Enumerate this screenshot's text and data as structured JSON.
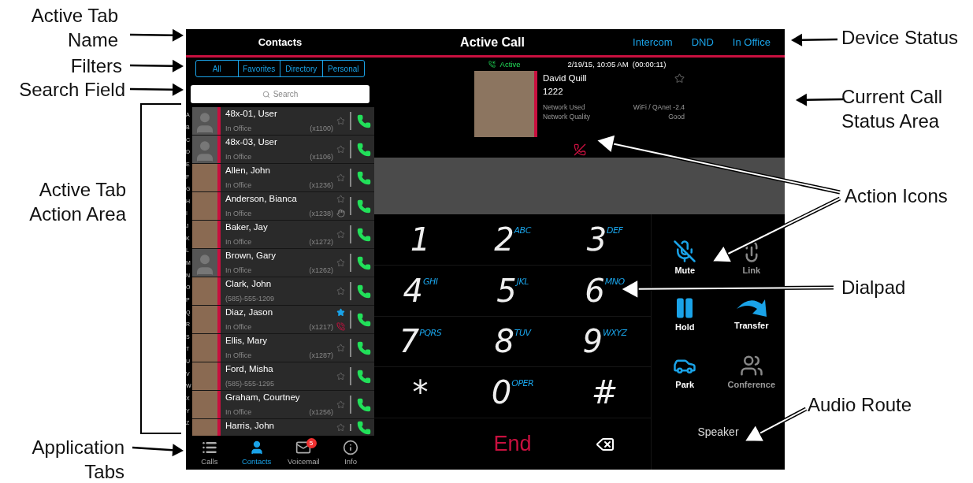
{
  "annotations": [
    {
      "text": "Active Tab Name"
    },
    {
      "text": "Filters"
    },
    {
      "text": "Search Field"
    },
    {
      "text": "Active Tab Action Area"
    },
    {
      "text": "Application Tabs"
    },
    {
      "text": "Device Status"
    },
    {
      "text": "Current Call Status Area"
    },
    {
      "text": "Action Icons"
    },
    {
      "text": "Dialpad"
    },
    {
      "text": "Audio Route"
    }
  ],
  "header": {
    "tab_title": "Contacts",
    "title": "Active Call",
    "device_status": [
      "Intercom",
      "DND",
      "In Office"
    ]
  },
  "filters": [
    {
      "label": "All",
      "selected": false
    },
    {
      "label": "Favorites",
      "selected": false
    },
    {
      "label": "Directory",
      "selected": false
    },
    {
      "label": "Personal",
      "selected": false
    }
  ],
  "search": {
    "placeholder": "Search"
  },
  "index_letters": [
    "A",
    "B",
    "C",
    "D",
    "E",
    "F",
    "G",
    "H",
    "I",
    "J",
    "K",
    "L",
    "M",
    "N",
    "O",
    "P",
    "Q",
    "R",
    "S",
    "T",
    "U",
    "V",
    "W",
    "X",
    "Y",
    "Z"
  ],
  "contacts": [
    {
      "name": "48x-01, User",
      "status": "In Office",
      "ext": "(x1100)",
      "favorite": false,
      "photo": false,
      "kind": "plain"
    },
    {
      "name": "48x-03, User",
      "status": "In Office",
      "ext": "(x1106)",
      "favorite": false,
      "photo": false,
      "kind": "plain"
    },
    {
      "name": "Allen, John",
      "status": "In Office",
      "ext": "(x1236)",
      "favorite": false,
      "photo": true,
      "kind": "plain"
    },
    {
      "name": "Anderson, Bianca",
      "status": "In Office",
      "ext": "(x1238)",
      "favorite": false,
      "photo": true,
      "kind": "dnd"
    },
    {
      "name": "Baker, Jay",
      "status": "In Office",
      "ext": "(x1272)",
      "favorite": false,
      "photo": true,
      "kind": "plain"
    },
    {
      "name": "Brown, Gary",
      "status": "In Office",
      "ext": "(x1262)",
      "favorite": false,
      "photo": false,
      "kind": "plain"
    },
    {
      "name": "Clark, John",
      "status": "(585)-555-1209",
      "favorite": false,
      "photo": true,
      "kind": "plain"
    },
    {
      "name": "Diaz, Jason",
      "status": "In Office",
      "ext": "(x1217)",
      "favorite": true,
      "photo": true,
      "kind": "ringing"
    },
    {
      "name": "Ellis, Mary",
      "status": "In Office",
      "ext": "(x1287)",
      "favorite": false,
      "photo": true,
      "kind": "plain"
    },
    {
      "name": "Ford, Misha",
      "status": "(585)-555-1295",
      "favorite": false,
      "photo": true,
      "kind": "plain"
    },
    {
      "name": "Graham, Courtney",
      "status": "In Office",
      "ext": "(x1256)",
      "favorite": false,
      "photo": true,
      "kind": "plain"
    },
    {
      "name": "Harris, John",
      "favorite": false,
      "photo": true,
      "kind": "plain"
    }
  ],
  "app_tabs": [
    {
      "label": "Calls",
      "selected": false
    },
    {
      "label": "Contacts",
      "selected": true
    },
    {
      "label": "Voicemail",
      "selected": false,
      "badge": "5"
    },
    {
      "label": "Info",
      "selected": false
    }
  ],
  "call": {
    "state": "Active",
    "datetime": "2/19/15, 10:05 AM  (00:00:11)",
    "name": "David Quill",
    "number": "1222",
    "favorite": false,
    "network": [
      {
        "label": "Network Used",
        "value": "WiFi / QAnet -2.4"
      },
      {
        "label": "Network Quality",
        "value": "Good"
      }
    ]
  },
  "dialpad": [
    {
      "kind": "digit",
      "digit": "1"
    },
    {
      "kind": "digit",
      "digit": "2",
      "letters": "ABC"
    },
    {
      "kind": "digit",
      "digit": "3",
      "letters": "DEF"
    },
    {
      "kind": "digit",
      "digit": "4",
      "letters": "GHI"
    },
    {
      "kind": "digit",
      "digit": "5",
      "letters": "JKL"
    },
    {
      "kind": "digit",
      "digit": "6",
      "letters": "MNO"
    },
    {
      "kind": "digit",
      "digit": "7",
      "letters": "PQRS"
    },
    {
      "kind": "digit",
      "digit": "8",
      "letters": "TUV"
    },
    {
      "kind": "digit",
      "digit": "9",
      "letters": "WXYZ"
    },
    {
      "kind": "digit",
      "digit": "*"
    },
    {
      "kind": "digit",
      "digit": "0",
      "letters": "OPER"
    },
    {
      "kind": "digit",
      "digit": "#"
    },
    {
      "kind": "end",
      "label": "End"
    },
    {
      "kind": "backspace"
    }
  ],
  "actions": [
    {
      "label": "Mute",
      "enabled": true
    },
    {
      "label": "Link",
      "enabled": false
    },
    {
      "label": "Hold",
      "enabled": true
    },
    {
      "label": "Transfer",
      "enabled": true
    },
    {
      "label": "Park",
      "enabled": true
    },
    {
      "label": "Conference",
      "enabled": false
    }
  ],
  "audio_route": "Speaker"
}
